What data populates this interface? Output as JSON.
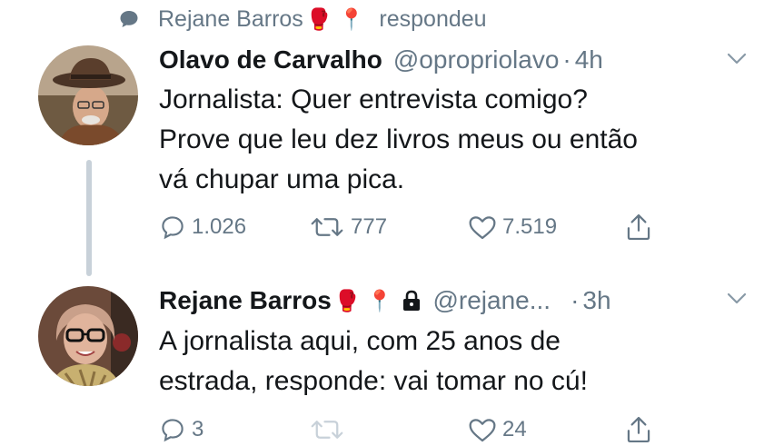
{
  "reply_header": {
    "name": "Rejane Barros",
    "emojis": "🥊 📍",
    "action_text": "respondeu"
  },
  "tweets": [
    {
      "name": "Olavo de Carvalho",
      "handle": "@opropriolavo",
      "separator": "·",
      "time": "4h",
      "text_lines": [
        "Jornalista: Quer entrevista comigo?",
        "Prove que leu dez livros meus ou então",
        "vá chupar uma pica."
      ],
      "reply_count": "1.026",
      "retweet_count": "777",
      "like_count": "7.519",
      "avatar": "avatar-man-hat"
    },
    {
      "name": "Rejane Barros",
      "emojis": "🥊 📍",
      "handle": "@rejane...",
      "separator": "·",
      "time": "3h",
      "text_lines": [
        "A jornalista aqui, com 25 anos de",
        "estrada, responde: vai tomar no cú!"
      ],
      "reply_count": "3",
      "retweet_count": "",
      "like_count": "24",
      "avatar": "avatar-woman-glasses"
    }
  ],
  "colors": {
    "text": "#14171a",
    "secondary": "#657786",
    "thread_line": "#c8d1d9",
    "icon": "#657786"
  }
}
